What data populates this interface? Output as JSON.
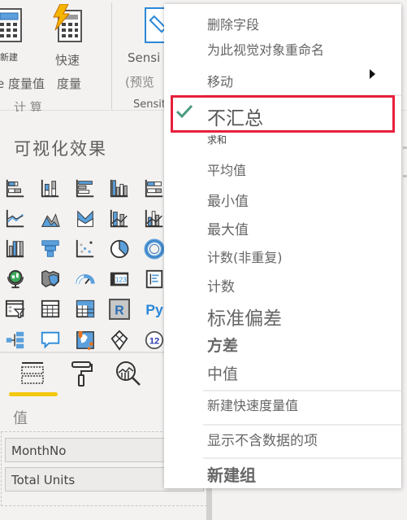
{
  "ribbon": {
    "new_measure": {
      "line1": "新建",
      "line2": "e 度量值",
      "icon": "calculator-icon"
    },
    "quick_measure": {
      "line1": "快速",
      "line2": "度量",
      "icon": "quick-measure-lightning-icon"
    },
    "calc_group_label": "计 算",
    "sensitivity": {
      "line1": "Sensi",
      "line2": "(预览",
      "icon": "sensitivity-label-icon"
    },
    "sensitivity_group_label": "Sensit"
  },
  "viz_panel": {
    "title": "可视化效果",
    "visual_icons": [
      "stacked-bar-chart-icon",
      "stacked-column-chart-icon",
      "clustered-bar-chart-icon",
      "clustered-column-chart-icon",
      "100-stacked-bar-chart-icon",
      "line-chart-icon",
      "area-chart-icon",
      "stacked-area-chart-icon",
      "line-and-stacked-column-chart-icon",
      "line-and-clustered-column-chart-icon",
      "ribbon-chart-icon",
      "funnel-chart-icon",
      "scatter-chart-icon",
      "pie-chart-icon",
      "donut-chart-icon",
      "map-globe-icon",
      "filled-map-icon",
      "gauge-icon",
      "card-icon",
      "multi-row-card-icon",
      "slicer-icon",
      "table-icon",
      "matrix-icon",
      "r-visual-icon",
      "python-visual-icon",
      "decomposition-tree-icon",
      "qa-chat-icon",
      "shape-map-icon",
      "power-apps-icon",
      "kpi-number-icon"
    ],
    "r_label": "R",
    "py_label": "Py",
    "kpi_label": "12",
    "card_label": "123",
    "pane_tabs": [
      "fields-tab",
      "format-tab",
      "analytics-tab"
    ],
    "values_label": "值",
    "fields": [
      "MonthNo",
      "Total Units"
    ]
  },
  "context_menu": {
    "items": [
      {
        "label": "删除字段"
      },
      {
        "label": "为此视觉对象重命名"
      },
      {
        "label": "移动",
        "has_submenu": true
      },
      {
        "label": "不汇总",
        "checked": true,
        "highlighted": true
      },
      {
        "label": "求和"
      },
      {
        "label": "平均值"
      },
      {
        "label": "最小值"
      },
      {
        "label": "最大值"
      },
      {
        "label": "计数(非重复)"
      },
      {
        "label": "计数"
      },
      {
        "label": "标准偏差"
      },
      {
        "label": "方差"
      },
      {
        "label": "中值"
      },
      {
        "label": "新建快速度量值"
      },
      {
        "label": "显示不含数据的项"
      },
      {
        "label": "新建组"
      }
    ],
    "highlight_color": "#e8203c",
    "check_color": "#4a9b7f"
  }
}
